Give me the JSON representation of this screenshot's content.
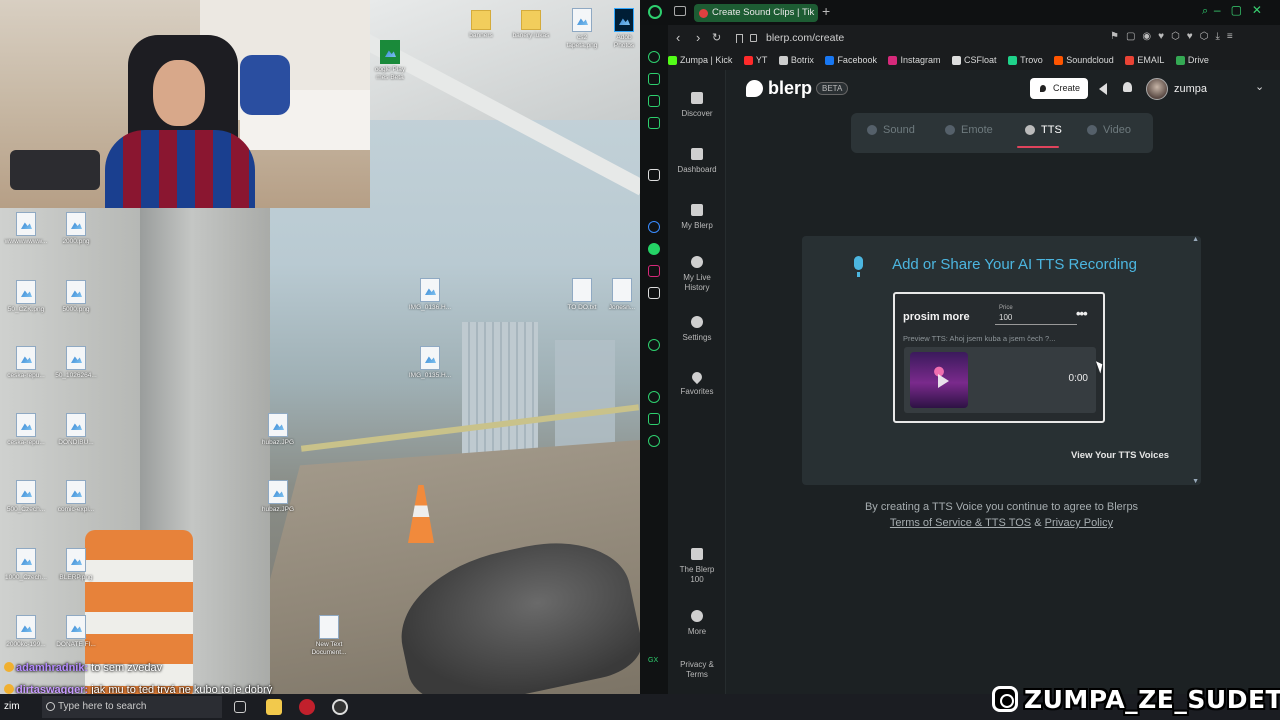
{
  "desktop": {
    "icons": [
      {
        "label": "oogle Play\nmes Beta"
      },
      {
        "label": "banners"
      },
      {
        "label": "banery lukas"
      },
      {
        "label": "cs2\ntapeta.png"
      },
      {
        "label": "Adob\nPhotos"
      },
      {
        "label": "wwwwwwww..."
      },
      {
        "label": "2000.png"
      },
      {
        "label": "50_CZK.png"
      },
      {
        "label": "5000.png"
      },
      {
        "label": "ceska-repu..."
      },
      {
        "label": "50_1026264..."
      },
      {
        "label": "ceska-repu..."
      },
      {
        "label": "DONDIBU..."
      },
      {
        "label": "500_Czech..."
      },
      {
        "label": "comic-expl..."
      },
      {
        "label": "1000_Czech..."
      },
      {
        "label": "BLERP.png"
      },
      {
        "label": "2000kc-199..."
      },
      {
        "label": "DONATE FI..."
      },
      {
        "label": "IMG_0136.H..."
      },
      {
        "label": "IMG_0135.H..."
      },
      {
        "label": "hubaz.JPG"
      },
      {
        "label": "hubaz.JPG"
      },
      {
        "label": "TO DO.txt"
      },
      {
        "label": "Jonesn..."
      },
      {
        "label": "New Text\nDocument..."
      }
    ]
  },
  "chat": [
    {
      "user": "adamhradnik:",
      "message": "to sem zvedav"
    },
    {
      "user": "dirtaswagger:",
      "message": "jak mu to ted trvá ne kubo to je dobrý"
    }
  ],
  "taskbar": {
    "start_label": "zim",
    "search_placeholder": "Type here to search"
  },
  "browser": {
    "tab_title": "Create Sound Clips | Tik",
    "address": "blerp.com/create",
    "bookmarks": [
      {
        "label": "Zumpa | Kick",
        "color": "#53fc18"
      },
      {
        "label": "YT",
        "color": "#ff2a2a"
      },
      {
        "label": "Botrix",
        "color": "#cccccc"
      },
      {
        "label": "Facebook",
        "color": "#1877f2"
      },
      {
        "label": "Instagram",
        "color": "#d6297a"
      },
      {
        "label": "CSFloat",
        "color": "#dddddd"
      },
      {
        "label": "Trovo",
        "color": "#1fd28a"
      },
      {
        "label": "Soundcloud",
        "color": "#ff5500"
      },
      {
        "label": "EMAIL",
        "color": "#ea4335"
      },
      {
        "label": "Drive",
        "color": "#34a853"
      }
    ]
  },
  "app": {
    "logo": "blerp",
    "beta": "BETA",
    "create_label": "Create",
    "username": "zumpa",
    "nav": [
      {
        "label": "Discover"
      },
      {
        "label": "Dashboard"
      },
      {
        "label": "My Blerp"
      },
      {
        "label": "My Live\nHistory"
      },
      {
        "label": "Settings"
      },
      {
        "label": "Favorites"
      },
      {
        "label": "The Blerp\n100"
      },
      {
        "label": "More"
      },
      {
        "label": "Privacy &\nTerms"
      }
    ],
    "modes": [
      {
        "label": "Sound"
      },
      {
        "label": "Emote"
      },
      {
        "label": "TTS"
      },
      {
        "label": "Video"
      }
    ],
    "card_title": "Add or Share Your AI TTS Recording",
    "voice": {
      "name": "prosim more",
      "price_label": "Price",
      "price": "100",
      "preview": "Preview TTS: Ahoj jsem kuba a jsem čech ?...",
      "time": "0:00"
    },
    "view_voices": "View Your TTS Voices",
    "terms_prefix": "By creating a TTS Voice you continue to agree to Blerps",
    "terms_link": "Terms of Service & TTS TOS",
    "terms_amp": "&",
    "privacy_link": "Privacy Policy"
  },
  "watermark": "ZUMPA_ZE_SUDET"
}
